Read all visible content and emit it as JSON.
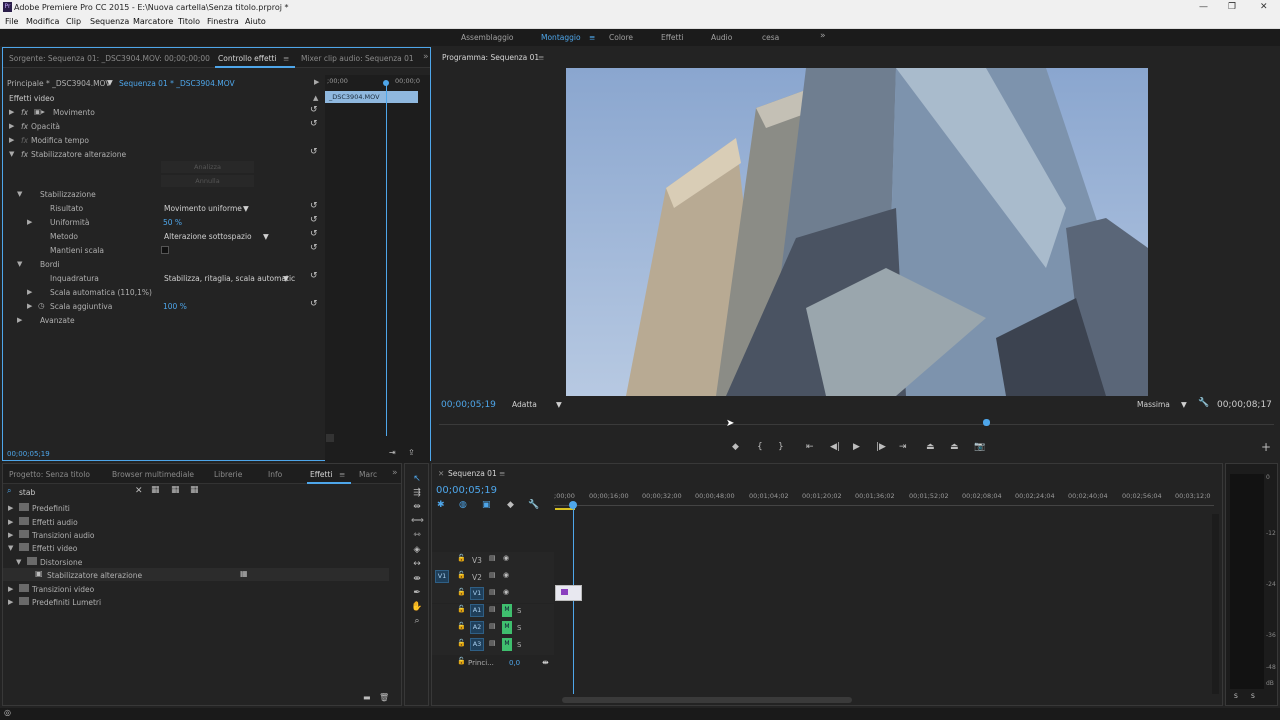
{
  "window": {
    "title": "Adobe Premiere Pro CC 2015 - E:\\Nuova cartella\\Senza titolo.prproj *",
    "logo": "Pr"
  },
  "menu": [
    "File",
    "Modifica",
    "Clip",
    "Sequenza",
    "Marcatore",
    "Titolo",
    "Finestra",
    "Aiuto"
  ],
  "workspaces": [
    {
      "label": "Assemblaggio"
    },
    {
      "label": "Montaggio"
    },
    {
      "label": "Colore"
    },
    {
      "label": "Effetti"
    },
    {
      "label": "Audio"
    },
    {
      "label": "cesa"
    }
  ],
  "workspace_more": "»",
  "effects_panel": {
    "tabs": [
      "Sorgente: Sequenza 01: _DSC3904.MOV: 00;00;00;00",
      "Controllo effetti",
      "Mixer clip audio: Sequenza 01"
    ],
    "tabs_more": "»",
    "master": "Principale * _DSC3904.MOV",
    "sequence": "Sequenza 01 * _DSC3904.MOV",
    "mini_ruler": [
      ";00;00",
      "00;00;0"
    ],
    "clip": "_DSC3904.MOV",
    "section": "Effetti video",
    "effects": [
      "Movimento",
      "Opacità",
      "Modifica tempo",
      "Stabilizzatore alterazione"
    ],
    "analyze": "Analizza",
    "cancel": "Annulla",
    "stabilization": "Stabilizzazione",
    "result_label": "Risultato",
    "result_value": "Movimento uniforme",
    "smooth_label": "Uniformità",
    "smooth_value": "50 %",
    "method_label": "Metodo",
    "method_value": "Alterazione sottospazio",
    "keep_scale": "Mantieni scala",
    "borders": "Bordi",
    "framing_label": "Inquadratura",
    "framing_value": "Stabilizza, ritaglia, scala automatic",
    "autoscale": "Scala automatica (110,1%)",
    "addscale_label": "Scala aggiuntiva",
    "addscale_value": "100 %",
    "advanced": "Avanzate",
    "timecode": "00;00;05;19"
  },
  "program": {
    "title": "Programma: Sequenza 01",
    "timecode": "00;00;05;19",
    "fit": "Adatta",
    "quality": "Massima",
    "duration": "00;00;08;17"
  },
  "project": {
    "tabs": [
      "Progetto: Senza titolo",
      "Browser multimediale",
      "Librerie",
      "Info",
      "Effetti",
      "Marc"
    ],
    "tabs_more": "»",
    "search": "stab",
    "tree": [
      "Predefiniti",
      "Effetti audio",
      "Transizioni audio",
      "Effetti video",
      "Distorsione",
      "Stabilizzatore alterazione",
      "Transizioni video",
      "Predefiniti Lumetri"
    ]
  },
  "timeline": {
    "title": "Sequenza 01",
    "timecode": "00;00;05;19",
    "ruler": [
      ";00;00",
      "00;00;16;00",
      "00;00;32;00",
      "00;00;48;00",
      "00;01;04;02",
      "00;01;20;02",
      "00;01;36;02",
      "00;01;52;02",
      "00;02;08;04",
      "00;02;24;04",
      "00;02;40;04",
      "00;02;56;04",
      "00;03;12;0"
    ],
    "video_tracks": [
      "V3",
      "V2",
      "V1"
    ],
    "source_v": "V1",
    "audio_tracks": [
      "A1",
      "A2",
      "A3"
    ],
    "mute": "M",
    "solo": "S",
    "master": "Princi...",
    "master_val": "0,0"
  },
  "meter": {
    "labels": [
      "0",
      "-12",
      "-24",
      "-36",
      "-48",
      "dB"
    ],
    "solo": [
      "S",
      "S"
    ]
  },
  "colors": {
    "accent": "#4ea6ea",
    "clip": "#e8e8f0",
    "audio": "#3fbf6e"
  }
}
